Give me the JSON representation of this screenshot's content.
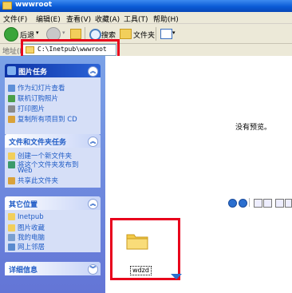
{
  "window": {
    "title": "wwwroot"
  },
  "menu": [
    "文件(F)",
    "编辑(E)",
    "查看(V)",
    "收藏(A)",
    "工具(T)",
    "帮助(H)"
  ],
  "toolbar": {
    "back_label": "后退",
    "search_label": "搜索",
    "folders_label": "文件夹"
  },
  "address": {
    "label": "地址(D)",
    "value": "C:\\Inetpub\\wwwroot"
  },
  "sidebar": {
    "picture_tasks": {
      "title": "图片任务",
      "items": [
        "作为幻灯片查看",
        "联机订购照片",
        "打印图片",
        "复制所有项目到 CD"
      ]
    },
    "file_tasks": {
      "title": "文件和文件夹任务",
      "items": [
        "创建一个新文件夹",
        "将这个文件夹发布到",
        "Web",
        "共享此文件夹"
      ]
    },
    "other_places": {
      "title": "其它位置",
      "items": [
        "Inetpub",
        "图片收藏",
        "我的电脑",
        "网上邻居"
      ]
    },
    "details": {
      "title": "详细信息"
    }
  },
  "content": {
    "preview_text": "没有预览。",
    "folder_name": "wdzd"
  },
  "colors": {
    "highlight": "#e8001c",
    "title_bar": "#0a5bd6",
    "sidebar": "#6375d6",
    "task_link": "#215dc6"
  }
}
